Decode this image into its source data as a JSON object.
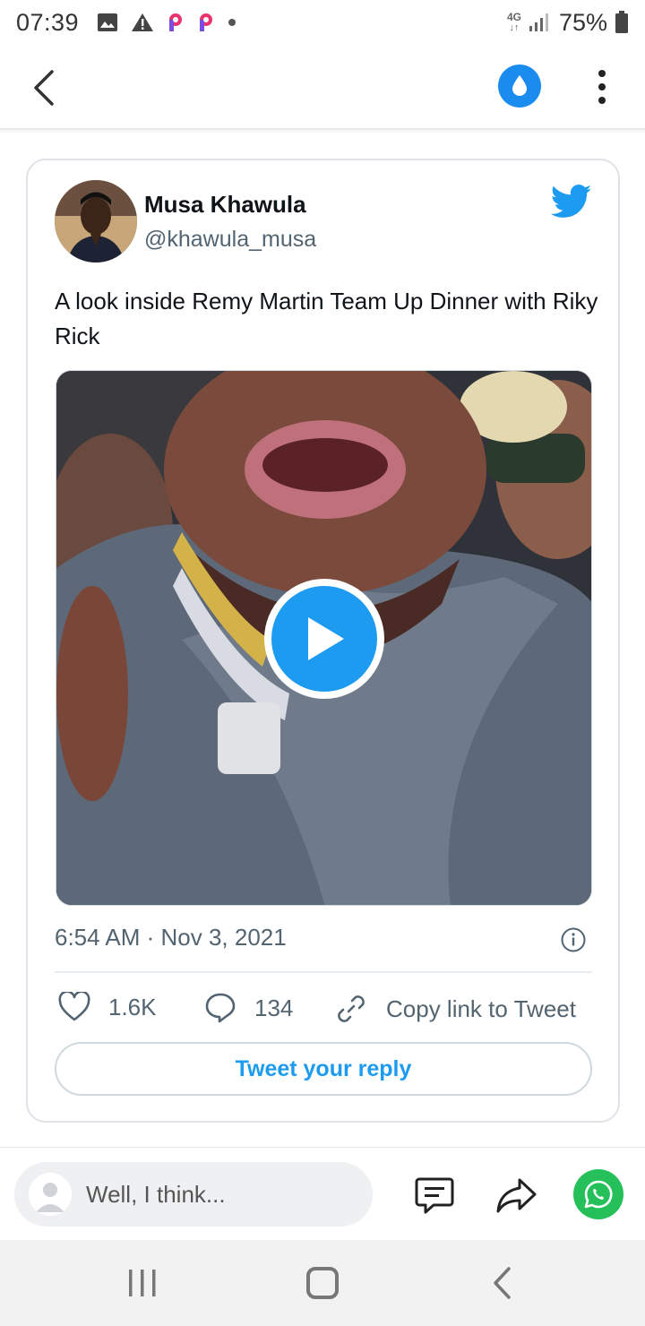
{
  "status_bar": {
    "time": "07:39",
    "network": "4G",
    "battery": "75%",
    "icons": [
      "image-icon",
      "warning-icon",
      "p-app-icon",
      "p-app-icon",
      "dot-icon",
      "signal-icon",
      "battery-icon"
    ]
  },
  "app_bar": {
    "icons": [
      "back-arrow-icon",
      "water-drop-icon",
      "more-vertical-icon"
    ],
    "accent_color": "#1a8cf0"
  },
  "tweet": {
    "author_name": "Musa Khawula",
    "author_handle": "@khawula_musa",
    "text": "A look inside Remy Martin Team Up Dinner with Riky Rick",
    "timestamp": "6:54 AM · Nov 3, 2021",
    "likes": "1.6K",
    "replies": "134",
    "copy_link_label": "Copy link to Tweet",
    "reply_button_label": "Tweet your reply",
    "brand_color": "#1d9bf0"
  },
  "comment_bar": {
    "placeholder": "Well, I think...",
    "icons": [
      "comments-icon",
      "share-icon",
      "whatsapp-icon"
    ],
    "whatsapp_color": "#25c05a"
  },
  "nav_bar": {
    "icons": [
      "recents-icon",
      "home-icon",
      "back-icon"
    ]
  }
}
